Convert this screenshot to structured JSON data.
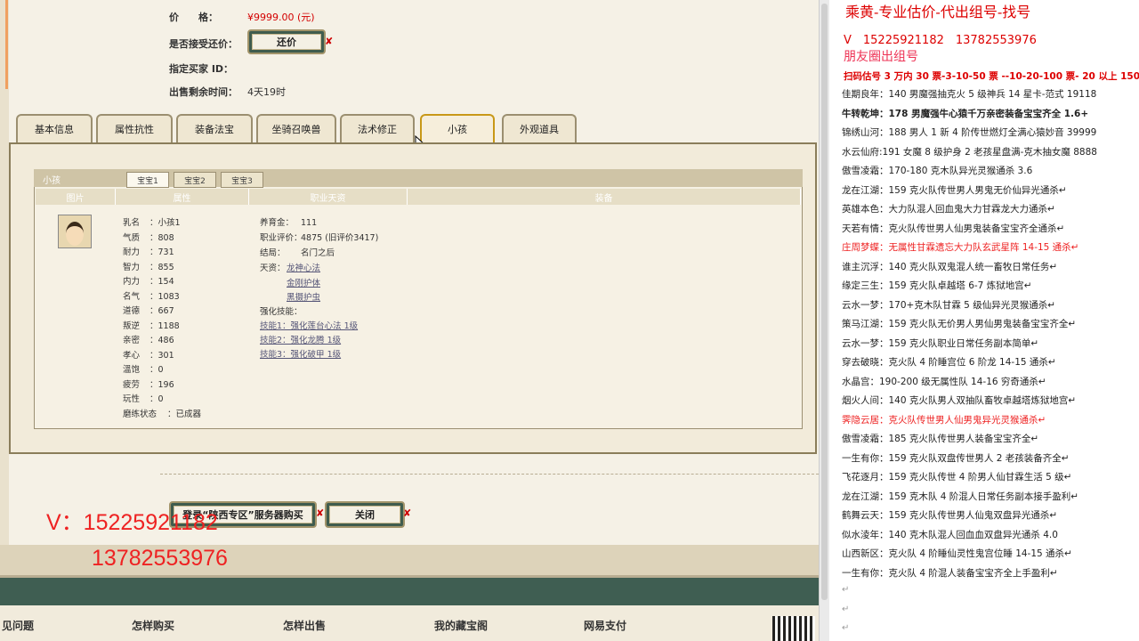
{
  "item": {
    "price_label": "价　　格：",
    "price_value": "¥9999.00 (元)",
    "accept_bargain_label": "是否接受还价：",
    "bargain_button": "还价",
    "buyer_id_label": "指定买家 ID：",
    "remaining_label": "出售剩余时间：",
    "remaining_value": "4天19时"
  },
  "tabs": [
    "基本信息",
    "属性抗性",
    "装备法宝",
    "坐骑召唤兽",
    "法术修正",
    "小孩",
    "外观道具"
  ],
  "active_tab": "小孩",
  "child_panel": {
    "title": "小孩",
    "subtabs": [
      "宝宝1",
      "宝宝2",
      "宝宝3"
    ],
    "columns": [
      "图片",
      "属性",
      "职业天资",
      "装备"
    ],
    "attributes": [
      {
        "k": "乳名",
        "v": "小孩1"
      },
      {
        "k": "气质",
        "v": "808"
      },
      {
        "k": "耐力",
        "v": "731"
      },
      {
        "k": "智力",
        "v": "855"
      },
      {
        "k": "内力",
        "v": "154"
      },
      {
        "k": "名气",
        "v": "1083"
      },
      {
        "k": "道德",
        "v": "667"
      },
      {
        "k": "叛逆",
        "v": "1188"
      },
      {
        "k": "亲密",
        "v": "486"
      },
      {
        "k": "孝心",
        "v": "301"
      },
      {
        "k": "溫饱",
        "v": "0"
      },
      {
        "k": "疲劳",
        "v": "196"
      },
      {
        "k": "玩性",
        "v": "0"
      },
      {
        "k": "磨练状态",
        "v": "已成器"
      }
    ],
    "career": {
      "feed_label": "养育金：",
      "feed_value": "111",
      "rating_label": "职业评价：",
      "rating_value": "4875 (旧评价3417)",
      "ending_label": "结局：",
      "ending_value": "名门之后",
      "talent_label": "天资：",
      "talents": [
        "龙神心法",
        "金刚护体",
        "黑摄护虫"
      ],
      "skills_label": "强化技能：",
      "skills": [
        "技能1：强化莲台心法 1级",
        "技能2：强化龙腾 1级",
        "技能3：强化破甲 1级"
      ]
    }
  },
  "actions": {
    "buy_button": "登录“陕西专区”服务器购买",
    "close_button": "关闭"
  },
  "footer": [
    "见问题",
    "怎样购买",
    "怎样出售",
    "我的藏宝阁",
    "网易支付"
  ],
  "overlay": {
    "v_line": "V：15225921182",
    "phone2": "13782553976"
  },
  "right_panel": {
    "title": "乘黄-专业估价-代出组号-找号",
    "phones": "V　15225921182　13782553976",
    "friend_circle": "朋友圈出组号",
    "price_rule": "扫码估号 3 万内 30 票-3-10-50 票 --10-20-100 票- 20 以上 150",
    "lines": [
      {
        "text": "佳期良年：140 男魔强抽克火 5 级神兵 14 星卡-范式 19118",
        "style": "normal"
      },
      {
        "text": "牛转乾坤：178 男魔强牛心猿千万亲密装备宝宝齐全 1.6+",
        "style": "bold"
      },
      {
        "text": "锦绣山河：188 男人 1 新 4 阶传世燃灯全满心猿妙音 39999",
        "style": "normal"
      },
      {
        "text": "水云仙府:191 女魔 8 级护身 2 老孩星盘满-克木抽女魔 8888",
        "style": "normal"
      },
      {
        "text": "傲雪凌霜：170-180 克木队异光灵猴通杀 3.6",
        "style": "normal"
      },
      {
        "text": "龙在江湖：159 克火队传世男人男鬼无价仙异光通杀↵",
        "style": "normal"
      },
      {
        "text": "英雄本色：大力队混人回血鬼大力甘霖龙大力通杀↵",
        "style": "normal"
      },
      {
        "text": "天若有情：克火队传世男人仙男鬼装备宝宝齐全通杀↵",
        "style": "normal"
      },
      {
        "text": "庄周梦蝶：无属性甘霖遗忘大力队玄武星阵 14-15 通杀↵",
        "style": "red"
      },
      {
        "text": "谁主沉浮：140 克火队双鬼混人统一畜牧日常任务↵",
        "style": "normal"
      },
      {
        "text": "缘定三生：159 克火队卓越塔 6-7 炼狱地宫↵",
        "style": "normal"
      },
      {
        "text": "云水一梦：170+克木队甘霖 5 级仙异光灵猴通杀↵",
        "style": "normal"
      },
      {
        "text": "策马江湖：159 克火队无价男人男仙男鬼装备宝宝齐全↵",
        "style": "normal"
      },
      {
        "text": "云水一梦：159 克火队职业日常任务副本简单↵",
        "style": "normal"
      },
      {
        "text": "穿去破晓：克火队 4 阶睡宫位 6 阶龙 14-15 通杀↵",
        "style": "normal"
      },
      {
        "text": "水晶宫：190-200 级无属性队 14-16 穷奇通杀↵",
        "style": "normal"
      },
      {
        "text": "烟火人间：140 克火队男人双抽队畜牧卓越塔炼狱地宫↵",
        "style": "normal"
      },
      {
        "text": "霁隐云居：克火队传世男人仙男鬼异光灵猴通杀↵",
        "style": "red"
      },
      {
        "text": "傲雪凌霜：185 克火队传世男人装备宝宝齐全↵",
        "style": "normal"
      },
      {
        "text": "一生有你：159 克火队双盘传世男人 2 老孩装备齐全↵",
        "style": "normal"
      },
      {
        "text": "飞花逐月：159 克火队传世 4 阶男人仙甘霖生活 5 级↵",
        "style": "normal"
      },
      {
        "text": "龙在江湖：159 克木队 4 阶混人日常任务副本接手盈利↵",
        "style": "normal"
      },
      {
        "text": "鹤舞云天：159 克火队传世男人仙鬼双盘异光通杀↵",
        "style": "normal"
      },
      {
        "text": "似水淩年：140 克木队混人回血血双盘异光通杀 4.0",
        "style": "normal"
      },
      {
        "text": "山西新区：克火队 4 阶睡仙灵性鬼宫位睡 14-15 通杀↵",
        "style": "normal"
      },
      {
        "text": "一生有你：克火队 4 阶混人装备宝宝齐全上手盈利↵",
        "style": "normal"
      }
    ],
    "trailing_marks": [
      "↵",
      "↵",
      "↵"
    ]
  }
}
